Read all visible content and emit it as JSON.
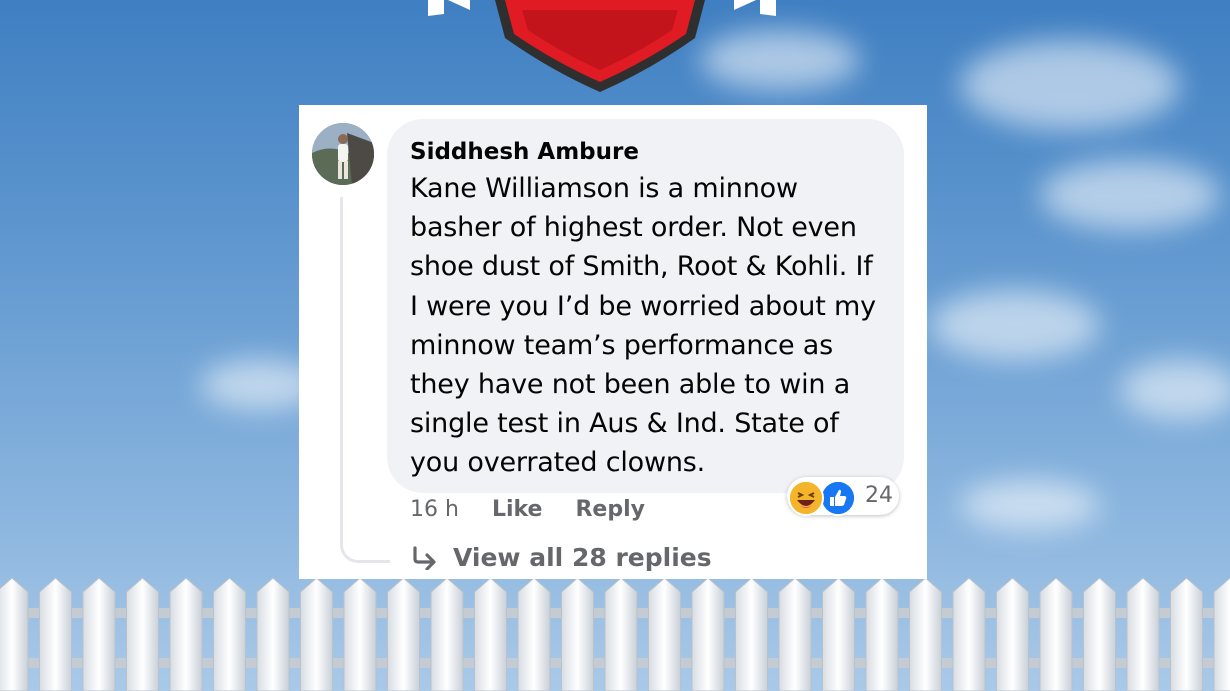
{
  "comment": {
    "author": "Siddhesh Ambure",
    "text": "Kane Williamson is a minnow basher of highest order. Not even shoe dust of Smith, Root & Kohli. If I were you I’d be worried about my minnow team’s performance as they have not been able to win a single test in Aus & Ind. State of you overrated clowns.",
    "time": "16 h",
    "like_label": "Like",
    "reply_label": "Reply",
    "reaction_count": "24",
    "reaction_icons": [
      "haha-emoji-icon",
      "like-reaction-icon"
    ],
    "view_replies_label": "View all 28 replies"
  },
  "colors": {
    "bubble": "#f0f2f5",
    "text": "#050505",
    "meta": "#65676b",
    "like_blue": "#1877f2",
    "shield_red": "#e01b24"
  }
}
